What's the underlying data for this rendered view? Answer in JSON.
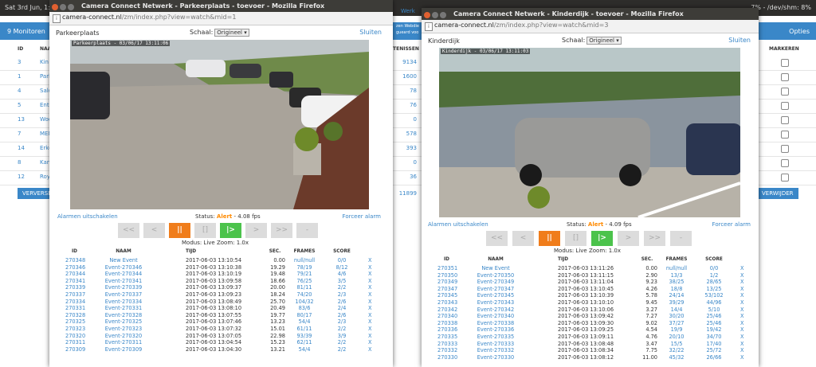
{
  "system_bar": {
    "left": "Sat 3rd Jun, 1:10pm",
    "right": "7% - /dev/shm: 8%"
  },
  "background_app": {
    "monitors_link": "9 Monitoren",
    "options_link": "Opties",
    "col_id": "ID",
    "col_name": "NAAM",
    "col_events": "TENISSEN",
    "col_mark": "MARKEREN",
    "header_link_partial": "Werk",
    "header_text_partial": "zen Webdie",
    "header_text2_partial": "gueard voo",
    "refresh_button": "VERVERSEN",
    "delete_button": "VERWIJDER",
    "rows": [
      {
        "id": "3",
        "name": "Kin",
        "count": "9134"
      },
      {
        "id": "1",
        "name": "Park",
        "count": "1600"
      },
      {
        "id": "4",
        "name": "Salo",
        "count": "78"
      },
      {
        "id": "5",
        "name": "Entr",
        "count": "76"
      },
      {
        "id": "13",
        "name": "Woo",
        "count": "0"
      },
      {
        "id": "7",
        "name": "MEN",
        "count": "578"
      },
      {
        "id": "14",
        "name": "Erke",
        "count": "393"
      },
      {
        "id": "8",
        "name": "Kan",
        "count": "0"
      },
      {
        "id": "12",
        "name": "Roy",
        "count": "36"
      }
    ],
    "total_count": "11899"
  },
  "windows": [
    {
      "title": "Camera Connect Netwerk - Parkeerplaats - toevoer - Mozilla Firefox",
      "url_domain": "camera-connect.nl",
      "url_path": "/zm/index.php?view=watch&mid=1",
      "monitor_name": "Parkeerplaats",
      "scale_label": "Schaal:",
      "scale_value": "Origineel",
      "close_link": "Sluiten",
      "stream_stamp": "Parkeerplaats - 03/06/17 13:11:06",
      "disable_alarms": "Alarmen uitschakelen",
      "status_label": "Status:",
      "status_state": "Alert",
      "status_fps": "- 4.08 fps",
      "force_alarm": "Forceer alarm",
      "mode_line": "Modus: Live   Zoom: 1.0x",
      "controls": [
        "<<",
        "<",
        "||",
        "[]",
        "|>",
        ">",
        ">>",
        "-"
      ],
      "columns": [
        "ID",
        "NAAM",
        "TIJD",
        "SEC.",
        "FRAMES",
        "SCORE"
      ],
      "events": [
        {
          "id": "270348",
          "name": "New Event",
          "time": "2017-06-03 13:10:54",
          "sec": "0.00",
          "frames": "null/null",
          "score": "0/0"
        },
        {
          "id": "270346",
          "name": "Event-270346",
          "time": "2017-06-03 13:10:38",
          "sec": "19.29",
          "frames": "78/19",
          "score": "8/12"
        },
        {
          "id": "270344",
          "name": "Event-270344",
          "time": "2017-06-03 13:10:19",
          "sec": "19.48",
          "frames": "79/21",
          "score": "4/6"
        },
        {
          "id": "270341",
          "name": "Event-270341",
          "time": "2017-06-03 13:09:58",
          "sec": "18.66",
          "frames": "76/25",
          "score": "3/5"
        },
        {
          "id": "270339",
          "name": "Event-270339",
          "time": "2017-06-03 13:09:37",
          "sec": "20.00",
          "frames": "81/11",
          "score": "2/2"
        },
        {
          "id": "270337",
          "name": "Event-270337",
          "time": "2017-06-03 13:09:23",
          "sec": "18.24",
          "frames": "74/20",
          "score": "2/3"
        },
        {
          "id": "270334",
          "name": "Event-270334",
          "time": "2017-06-03 13:08:49",
          "sec": "25.70",
          "frames": "104/32",
          "score": "2/6"
        },
        {
          "id": "270331",
          "name": "Event-270331",
          "time": "2017-06-03 13:08:10",
          "sec": "20.49",
          "frames": "83/6",
          "score": "2/4"
        },
        {
          "id": "270328",
          "name": "Event-270328",
          "time": "2017-06-03 13:07:55",
          "sec": "19.77",
          "frames": "80/17",
          "score": "2/6"
        },
        {
          "id": "270325",
          "name": "Event-270325",
          "time": "2017-06-03 13:07:46",
          "sec": "13.23",
          "frames": "54/4",
          "score": "2/3"
        },
        {
          "id": "270323",
          "name": "Event-270323",
          "time": "2017-06-03 13:07:32",
          "sec": "15.01",
          "frames": "61/11",
          "score": "2/2"
        },
        {
          "id": "270320",
          "name": "Event-270320",
          "time": "2017-06-03 13:07:05",
          "sec": "22.98",
          "frames": "93/39",
          "score": "3/9"
        },
        {
          "id": "270311",
          "name": "Event-270311",
          "time": "2017-06-03 13:04:54",
          "sec": "15.23",
          "frames": "62/11",
          "score": "2/2"
        },
        {
          "id": "270309",
          "name": "Event-270309",
          "time": "2017-06-03 13:04:30",
          "sec": "13.21",
          "frames": "54/4",
          "score": "2/2"
        }
      ]
    },
    {
      "title": "Camera Connect Netwerk - Kinderdijk - toevoer - Mozilla Firefox",
      "url_domain": "camera-connect.nl",
      "url_path": "/zm/index.php?view=watch&mid=3",
      "monitor_name": "Kinderdijk",
      "scale_label": "Schaal:",
      "scale_value": "Origineel",
      "close_link": "Sluiten",
      "stream_stamp": "Kinderdijk - 03/06/17 13:11:03",
      "disable_alarms": "Alarmen uitschakelen",
      "status_label": "Status:",
      "status_state": "Alert",
      "status_fps": "- 4.09 fps",
      "force_alarm": "Forceer alarm",
      "mode_line": "Modus: Live   Zoom: 1.0x",
      "controls": [
        "<<",
        "<",
        "||",
        "[]",
        "|>",
        ">",
        ">>",
        "-"
      ],
      "columns": [
        "ID",
        "NAAM",
        "TIJD",
        "SEC.",
        "FRAMES",
        "SCORE"
      ],
      "events": [
        {
          "id": "270351",
          "name": "New Event",
          "time": "2017-06-03 13:11:26",
          "sec": "0.00",
          "frames": "null/null",
          "score": "0/0"
        },
        {
          "id": "270350",
          "name": "Event-270350",
          "time": "2017-06-03 13:11:15",
          "sec": "2.90",
          "frames": "13/3",
          "score": "1/2"
        },
        {
          "id": "270349",
          "name": "Event-270349",
          "time": "2017-06-03 13:11:04",
          "sec": "9.23",
          "frames": "38/25",
          "score": "28/65"
        },
        {
          "id": "270347",
          "name": "Event-270347",
          "time": "2017-06-03 13:10:45",
          "sec": "4.26",
          "frames": "18/8",
          "score": "13/25"
        },
        {
          "id": "270345",
          "name": "Event-270345",
          "time": "2017-06-03 13:10:39",
          "sec": "5.78",
          "frames": "24/14",
          "score": "53/102"
        },
        {
          "id": "270343",
          "name": "Event-270343",
          "time": "2017-06-03 13:10:10",
          "sec": "9.45",
          "frames": "39/29",
          "score": "44/96"
        },
        {
          "id": "270342",
          "name": "Event-270342",
          "time": "2017-06-03 13:10:06",
          "sec": "3.27",
          "frames": "14/4",
          "score": "5/10"
        },
        {
          "id": "270340",
          "name": "Event-270340",
          "time": "2017-06-03 13:09:42",
          "sec": "7.27",
          "frames": "30/20",
          "score": "25/46"
        },
        {
          "id": "270338",
          "name": "Event-270338",
          "time": "2017-06-03 13:09:30",
          "sec": "9.02",
          "frames": "37/27",
          "score": "25/46"
        },
        {
          "id": "270336",
          "name": "Event-270336",
          "time": "2017-06-03 13:09:25",
          "sec": "4.54",
          "frames": "19/9",
          "score": "19/42"
        },
        {
          "id": "270335",
          "name": "Event-270335",
          "time": "2017-06-03 13:09:11",
          "sec": "4.76",
          "frames": "20/10",
          "score": "34/70"
        },
        {
          "id": "270333",
          "name": "Event-270333",
          "time": "2017-06-03 13:08:48",
          "sec": "3.47",
          "frames": "15/5",
          "score": "17/40"
        },
        {
          "id": "270332",
          "name": "Event-270332",
          "time": "2017-06-03 13:08:34",
          "sec": "7.75",
          "frames": "32/22",
          "score": "25/72"
        },
        {
          "id": "270330",
          "name": "Event-270330",
          "time": "2017-06-03 13:08:12",
          "sec": "11.00",
          "frames": "45/32",
          "score": "26/66"
        }
      ]
    }
  ]
}
